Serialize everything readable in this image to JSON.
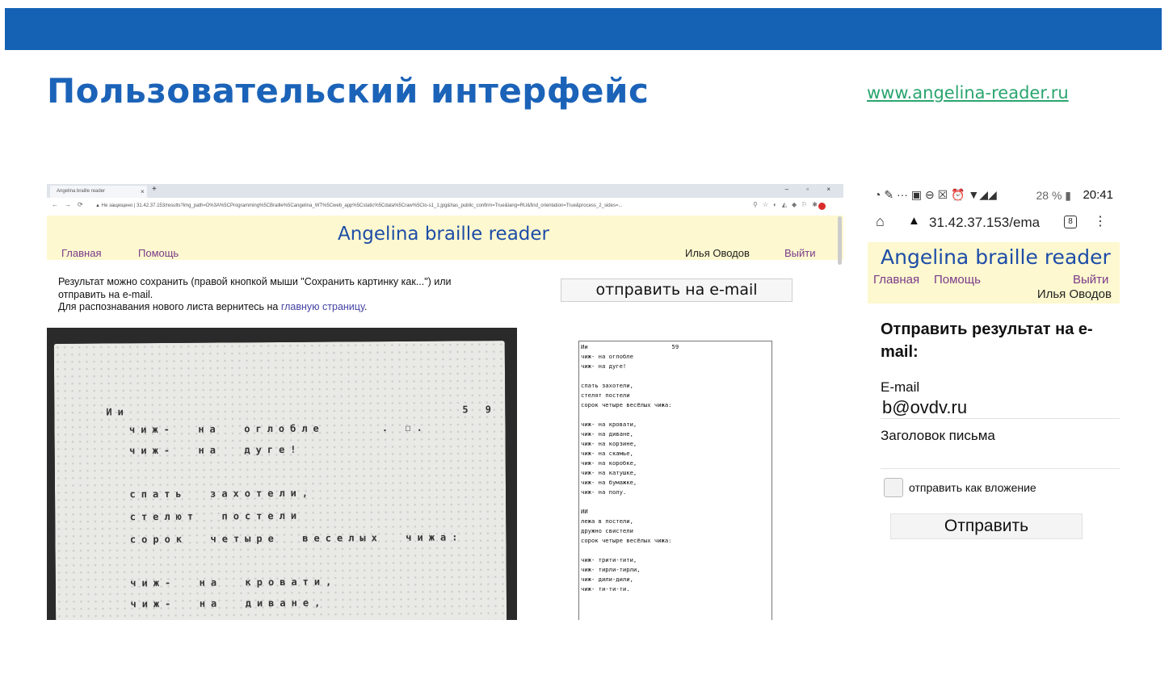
{
  "slide": {
    "title": "Пользовательский интерфейс",
    "link": "www.angelina-reader.ru",
    "accent_color": "#1562b5"
  },
  "desktop": {
    "tab_title": "Angelina braille reader",
    "tab_close": "×",
    "new_tab": "+",
    "window_controls": "–  ▫  ×",
    "nav_glyphs": "←→⟳",
    "url": "▲ Не защищено | 31.42.37.153/results?img_path=D%3A%5CProgramming%5CBraille%5Cangelina_WT%5Cweb_app%5Cstatic%5Cdata%5Craw%5Cto-s1_1.jpg&has_public_confirm=True&lang=RU&find_orientation=True&process_2_sides=...",
    "ext_icons": "⚲☆◐◭◆⚐✱",
    "app_title": "Angelina braille reader",
    "nav": {
      "home": "Главная",
      "help": "Помощь",
      "logout": "Выйти"
    },
    "user": "Илья Оводов",
    "info_line1": "Результат можно сохранить (правой кнопкой мыши \"Сохранить картинку как...\") или",
    "info_line2": "отправить на e-mail.",
    "info_line3_prefix": "Для распознавания нового листа вернитесь на ",
    "info_line3_link": "главную страницу",
    "info_line3_suffix": ".",
    "email_button": "отправить на e-mail",
    "photo_lines": [
      "Ии                             5 9",
      "  чиж-  на  оглобле     . ☐.",
      "  чиж-  на  дуге!",
      "",
      "  спать  захотели,",
      "  стелют  постели",
      "  сорок  четыре  веселых  чижа:",
      "",
      "  чиж-  на  кровати,",
      "  чиж-  на  диване,"
    ],
    "result_text": "Ии                        59\nчиж- на оглобле\nчиж- на дуге!\n\nспать захотели,\nстелят постели\nсорок четыре весёлых чижа:\n\nчиж- на кровати,\nчиж- на диване,\nчиж- на корзине,\nчиж- на скамье,\nчиж- на коробке,\nчиж- на катушке,\nчиж- на бумажке,\nчиж- на полу.\n\nИИ\nлежа в постели,\nдружно свистели\nсорок четыре весёлых чижа:\n\nчиж- трити-тити,\nчиж- тирли-тирли,\nчиж- дили-дили,\nчиж- ти-ти-ти."
  },
  "mobile": {
    "status_icons": "◔ ✎   ···   ▣ ⊖ ☒ ⏰ ▼◢◢",
    "battery": "28 % ▮",
    "time": "20:41",
    "home_glyph": "⌂",
    "warn_glyph": "▲",
    "url": "31.42.37.153/ema",
    "tabs_count": "8",
    "menu_glyph": "⋮",
    "app_title": "Angelina braille reader",
    "nav": {
      "home": "Главная",
      "help": "Помощь",
      "logout": "Выйти"
    },
    "user": "Илья Оводов",
    "form_title": "Отправить результат на e-mail:",
    "email_label": "E-mail",
    "email_value": "b@ovdv.ru",
    "subject_label": "Заголовок письма",
    "subject_value": "",
    "attach_label": "отправить как вложение",
    "attach_checked": false,
    "submit": "Отправить"
  }
}
